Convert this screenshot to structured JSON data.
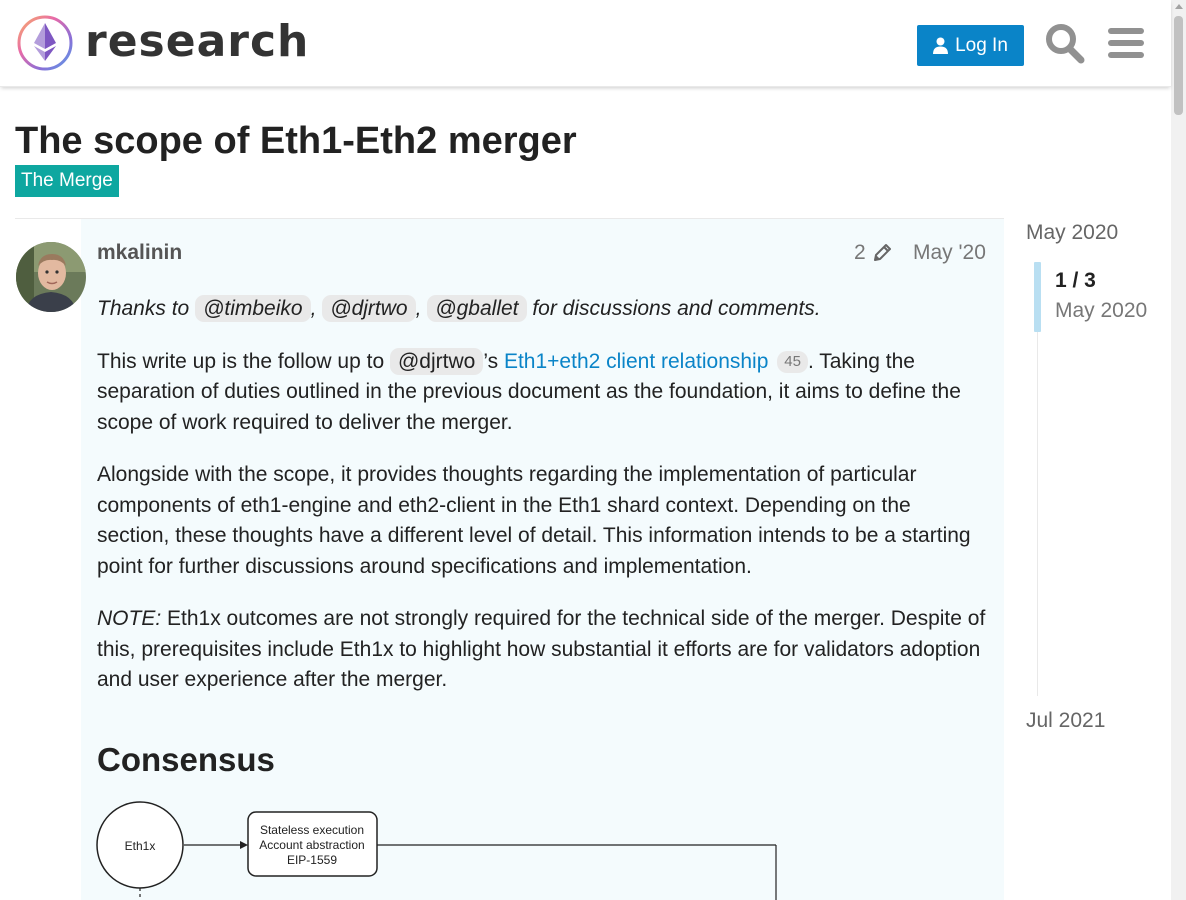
{
  "header": {
    "site_name": "research",
    "login_label": "Log In",
    "icons": [
      "logo-icon",
      "user-icon",
      "search-icon",
      "hamburger-menu-icon"
    ]
  },
  "topic": {
    "title": "The scope of Eth1-Eth2 merger",
    "category": "The Merge",
    "category_color": "#0ea7a0"
  },
  "post": {
    "username": "mkalinin",
    "edit_count": "2",
    "date": "May '20",
    "thanks": {
      "prefix": "Thanks to",
      "mentions": [
        "@timbeiko",
        "@djrtwo",
        "@gballet"
      ],
      "sep1": ",",
      "sep2": ",",
      "suffix": "for discussions and comments."
    },
    "para1": {
      "prefix": "This write up is the follow up to",
      "mention": "@djrtwo",
      "possessive": "’s",
      "link_text": "Eth1+eth2 client relationship",
      "link_clicks": "45",
      "suffix": ". Taking the separation of duties outlined in the previous document as the foundation, it aims to define the scope of work required to deliver the merger."
    },
    "para2": "Alongside with the scope, it provides thoughts regarding the implementation of particular components of eth1-engine and eth2-client in the Eth1 shard context. Depending on the section, these thoughts have a different level of detail. This information intends to be a starting point for further discussions around specifications and implementation.",
    "note": {
      "label": "NOTE:",
      "text": "Eth1x outcomes are not strongly required for the technical side of the merger. Despite of this, prerequisites include Eth1x to highlight how substantial it efforts are for validators adoption and user experience after the merger."
    },
    "heading": "Consensus",
    "diagram": {
      "node1": "Eth1x",
      "box_lines": [
        "Stateless execution",
        "Account abstraction",
        "EIP-1559"
      ]
    }
  },
  "timeline": {
    "start": "May 2020",
    "position": "1 / 3",
    "current_date": "May 2020",
    "end": "Jul 2021"
  },
  "colors": {
    "accent": "#0a84c8",
    "post_highlight": "#f4fbfd",
    "timeline_handle": "#b9dff2"
  }
}
